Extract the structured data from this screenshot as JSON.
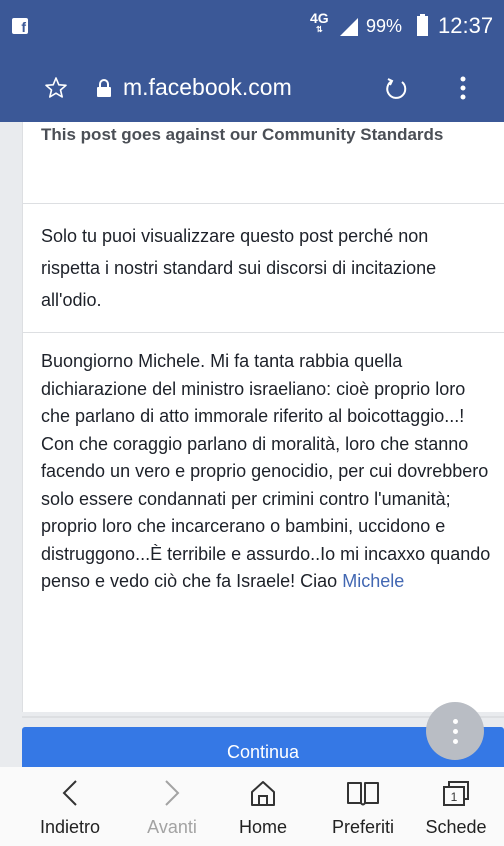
{
  "status_bar": {
    "network": "4G",
    "battery": "99%",
    "time": "12:37"
  },
  "browser": {
    "url": "m.facebook.com"
  },
  "post": {
    "title": "This post goes against our Community Standards",
    "notice": "Solo tu puoi visualizzare questo post perché non rispetta i nostri standard sui discorsi di incitazione all'odio.",
    "body": "Buongiorno Michele. Mi fa tanta rabbia quella dichiarazione del ministro israeliano: cioè proprio loro che parlano di atto immorale riferito al boicottaggio...! Con che coraggio parlano di moralità, loro che stanno facendo un vero e proprio genocidio, per cui dovrebbero solo essere condannati per crimini contro l'umanità; proprio loro che incarcerano o bambini, uccidono e distruggono...È terribile e assurdo..Io mi incaxxo quando penso e vedo ciò che fa Israele! Ciao",
    "mention": "Michele"
  },
  "continue_label": "Continua",
  "bottom_nav": {
    "back": "Indietro",
    "forward": "Avanti",
    "home": "Home",
    "bookmarks": "Preferiti",
    "tabs": "Schede",
    "tab_count": "1"
  },
  "colors": {
    "brand": "#3b5897",
    "button": "#3578e5",
    "mention": "#4267b2"
  }
}
